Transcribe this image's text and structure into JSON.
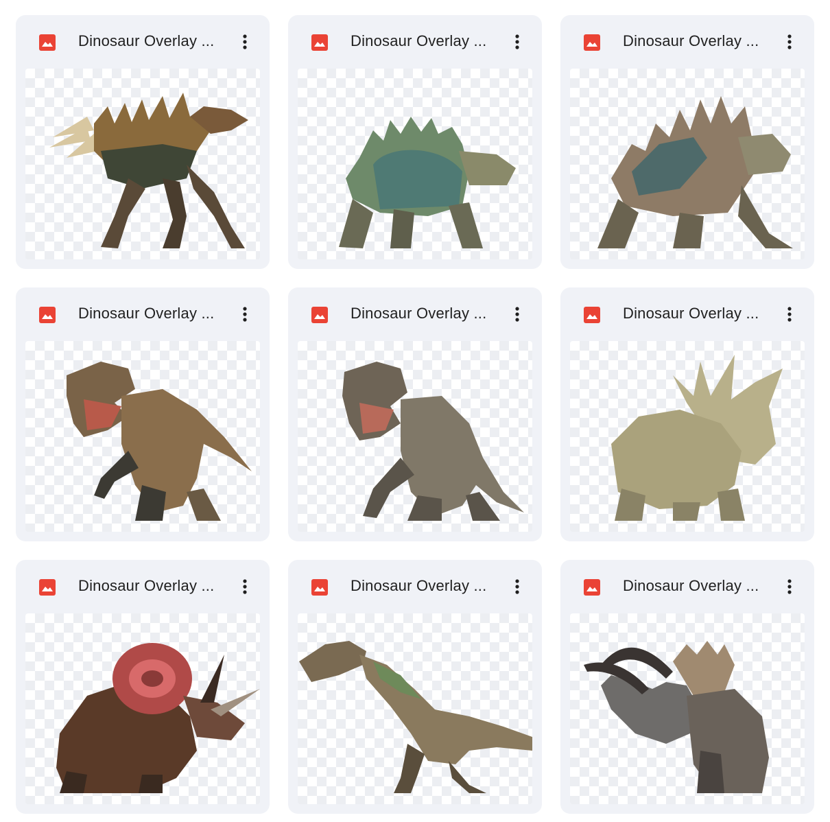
{
  "files": [
    {
      "title": "Dinosaur Overlay ...",
      "icon": "image-file-icon",
      "subject": "spiked-raptor"
    },
    {
      "title": "Dinosaur Overlay ...",
      "icon": "image-file-icon",
      "subject": "armored-ankylosaur"
    },
    {
      "title": "Dinosaur Overlay ...",
      "icon": "image-file-icon",
      "subject": "spiked-ankylosaur"
    },
    {
      "title": "Dinosaur Overlay ...",
      "icon": "image-file-icon",
      "subject": "roaring-trex"
    },
    {
      "title": "Dinosaur Overlay ...",
      "icon": "image-file-icon",
      "subject": "roaring-trex-gray"
    },
    {
      "title": "Dinosaur Overlay ...",
      "icon": "image-file-icon",
      "subject": "horned-styracosaur"
    },
    {
      "title": "Dinosaur Overlay ...",
      "icon": "image-file-icon",
      "subject": "red-frill-triceratops"
    },
    {
      "title": "Dinosaur Overlay ...",
      "icon": "image-file-icon",
      "subject": "long-neck-raptor"
    },
    {
      "title": "Dinosaur Overlay ...",
      "icon": "image-file-icon",
      "subject": "gray-triceratops"
    }
  ],
  "colors": {
    "card_background": "#f0f2f7",
    "image_icon_red": "#ea4335",
    "text": "#1f1f1f"
  }
}
